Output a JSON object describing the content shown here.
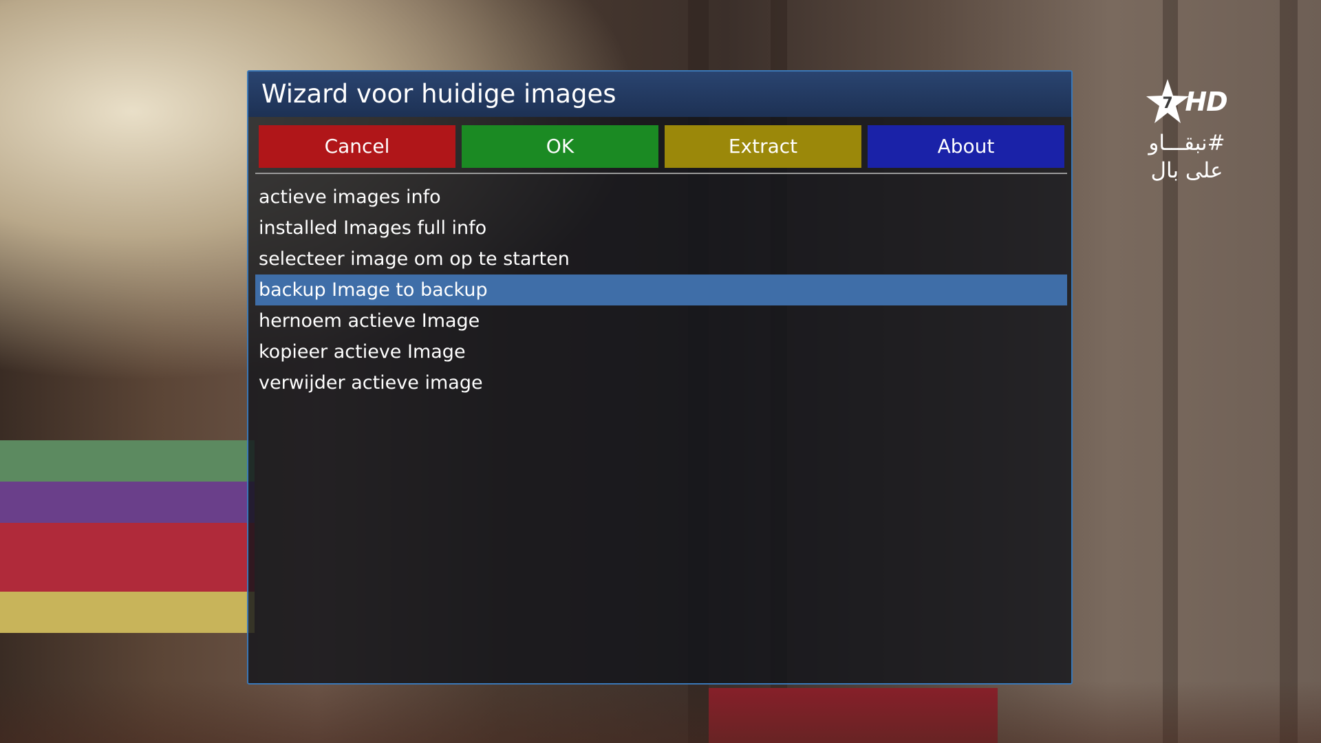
{
  "dialog": {
    "title": "Wizard voor huidige images"
  },
  "buttons": {
    "cancel": "Cancel",
    "ok": "OK",
    "extract": "Extract",
    "about": "About"
  },
  "colors": {
    "cancel": "#b01619",
    "ok": "#1b8a23",
    "extract": "#9b880a",
    "about": "#1a22a8",
    "selection": "#3f6ea8",
    "titlebar": "#1d3154"
  },
  "menu": {
    "selected_index": 3,
    "items": [
      {
        "label": "actieve images info"
      },
      {
        "label": "installed Images full info"
      },
      {
        "label": "selecteer image om op te starten"
      },
      {
        "label": "backup Image to backup"
      },
      {
        "label": "hernoem actieve Image"
      },
      {
        "label": "kopieer actieve Image"
      },
      {
        "label": "verwijder actieve image"
      }
    ]
  },
  "channel_logo": {
    "number": "7",
    "hd": "HD",
    "line1": "#نبقـــاو",
    "line2": "على بال",
    "icon": "star-icon"
  }
}
